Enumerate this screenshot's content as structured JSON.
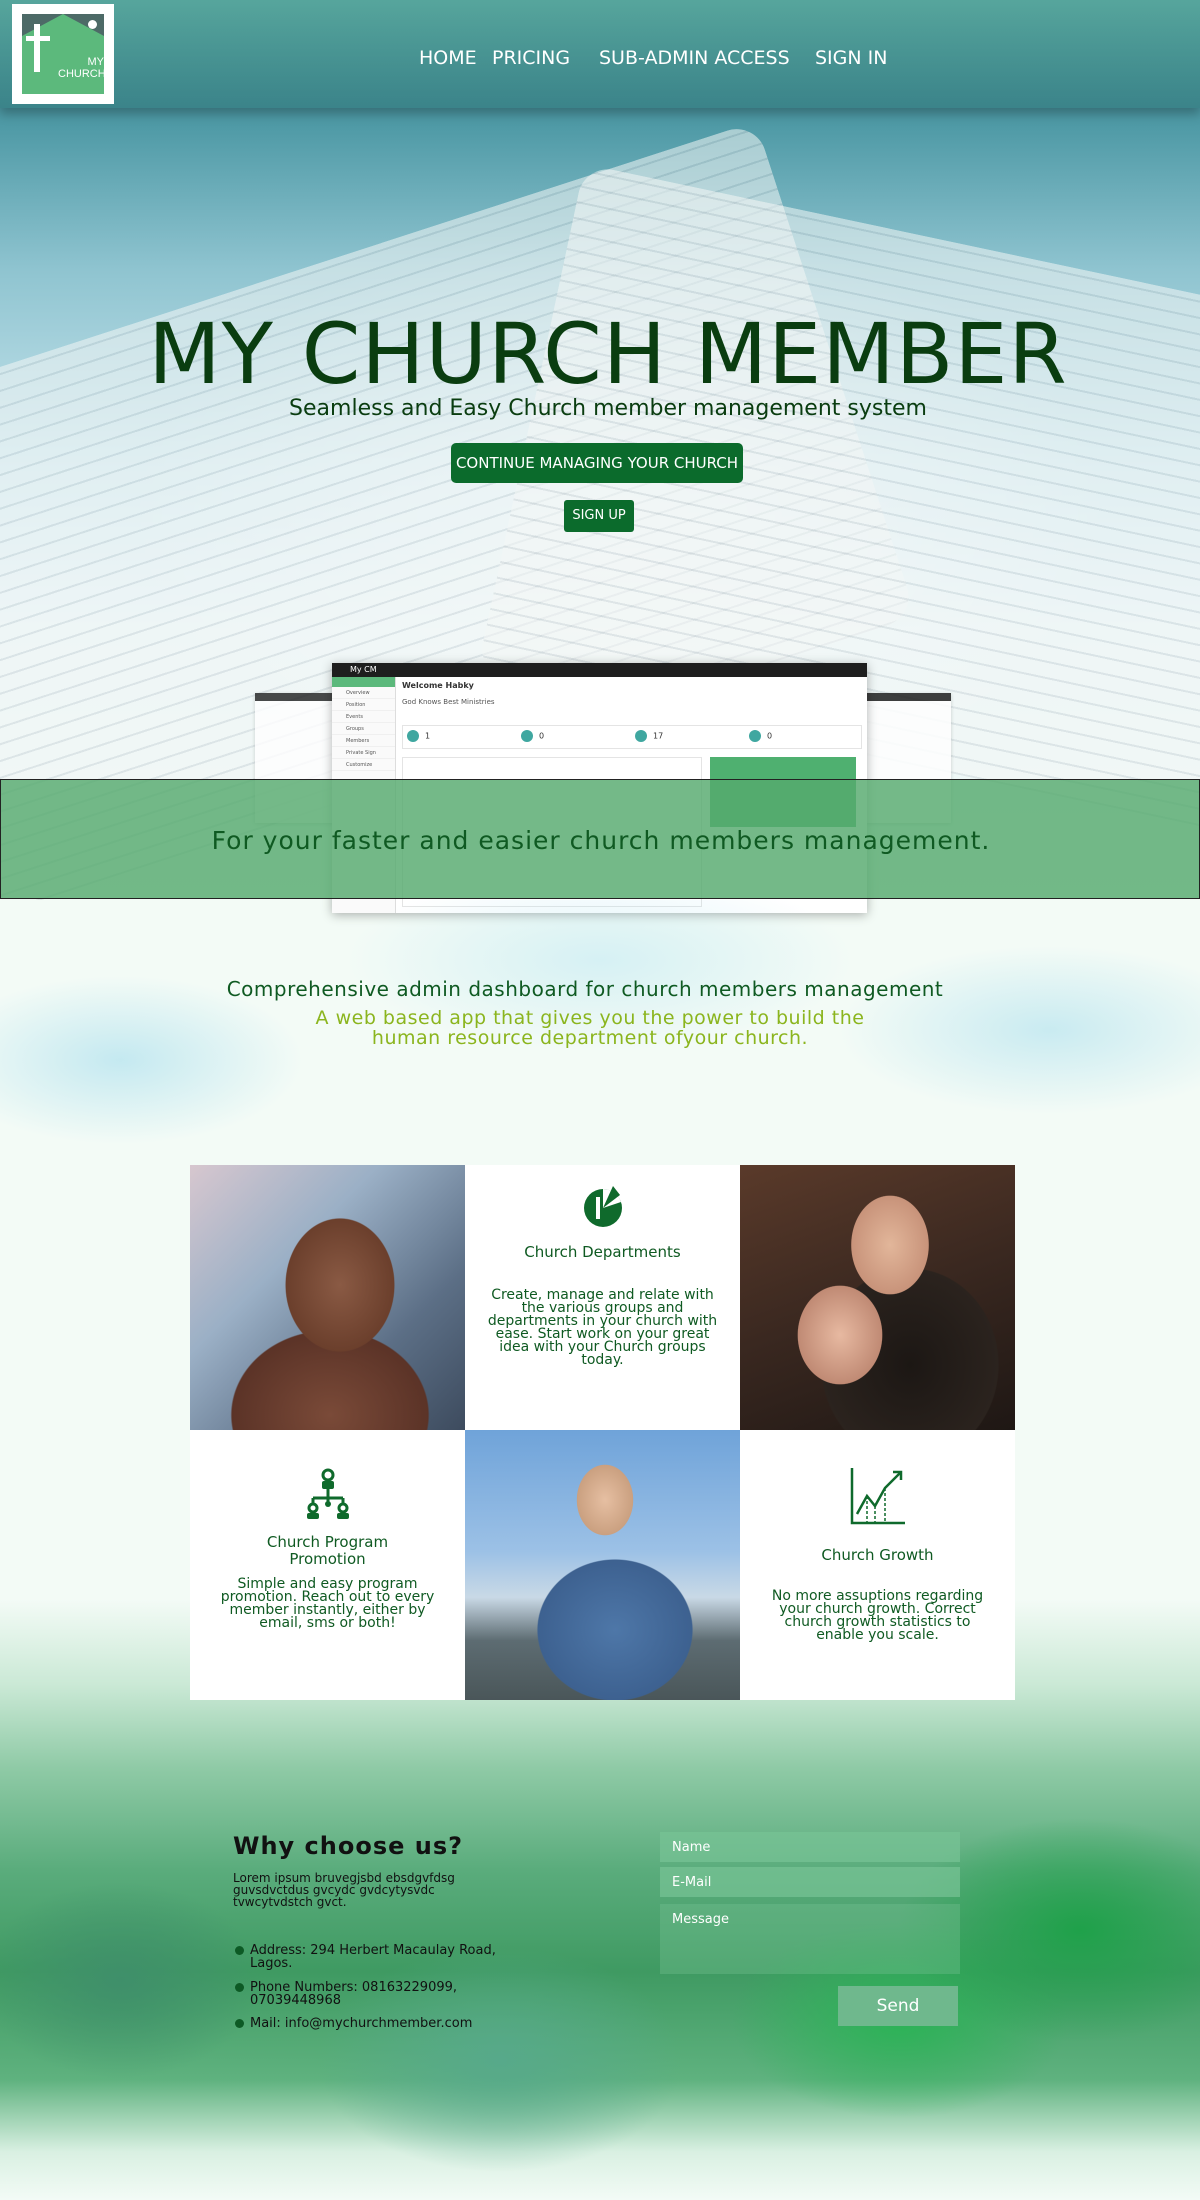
{
  "logo": {
    "text_line1": "MY",
    "text_line2": "CHURCH"
  },
  "nav": {
    "items": [
      {
        "label": "HOME"
      },
      {
        "label": "PRICING"
      },
      {
        "label": "SUB-ADMIN ACCESS"
      },
      {
        "label": "SIGN IN"
      }
    ]
  },
  "hero": {
    "title": "MY CHURCH MEMBER",
    "subtitle": "Seamless and Easy Church member management system",
    "continue_button": "CONTINUE MANAGING YOUR CHURCH",
    "signup_button": "SIGN UP"
  },
  "mockup": {
    "app_name": "My CM",
    "welcome": "Welcome Habky",
    "org": "God Knows Best Ministries",
    "stats": [
      "1",
      "0",
      "17",
      "0"
    ],
    "sidebar_items": [
      "Overview",
      "Position",
      "Events",
      "Groups",
      "Members",
      "Private Sign",
      "Customize"
    ]
  },
  "banner": {
    "text": "For your faster and easier church members management."
  },
  "intro": {
    "title": "Comprehensive admin dashboard for church members management",
    "subtitle": "A web based app that gives you the power to build the human resource department ofyour church."
  },
  "features": [
    {
      "title": "Church Departments",
      "description": "Create, manage and relate with the various groups and departments in your church with ease. Start work on your great idea with your Church groups today.",
      "icon": "pie-chart-icon"
    },
    {
      "title": "Church Program Promotion",
      "description": "Simple and easy program promotion. Reach out to every member instantly, either by email, sms or both!",
      "icon": "hierarchy-icon"
    },
    {
      "title": "Church Growth",
      "description": "No more assuptions regarding your church growth. Correct church growth statistics to enable you scale.",
      "icon": "growth-chart-icon"
    }
  ],
  "why": {
    "title": "Why choose us?",
    "lorem": "Lorem ipsum bruvegjsbd ebsdgvfdsg guvsdvctdus gvcydc gvdcytysvdc tvwcytvdstch gvct.",
    "address": "Address: 294 Herbert Macaulay Road, Lagos.",
    "phone": "Phone Numbers: 08163229099, 07039448968",
    "mail": "Mail: info@mychurchmember.com"
  },
  "form": {
    "name_placeholder": "Name",
    "email_placeholder": "E-Mail",
    "message_placeholder": "Message",
    "send_button": "Send"
  },
  "colors": {
    "dark_green": "#0a3d10",
    "button_green": "#0b6b2c",
    "lime_text": "#8bb51e",
    "banner_green": "#56aa6e"
  }
}
